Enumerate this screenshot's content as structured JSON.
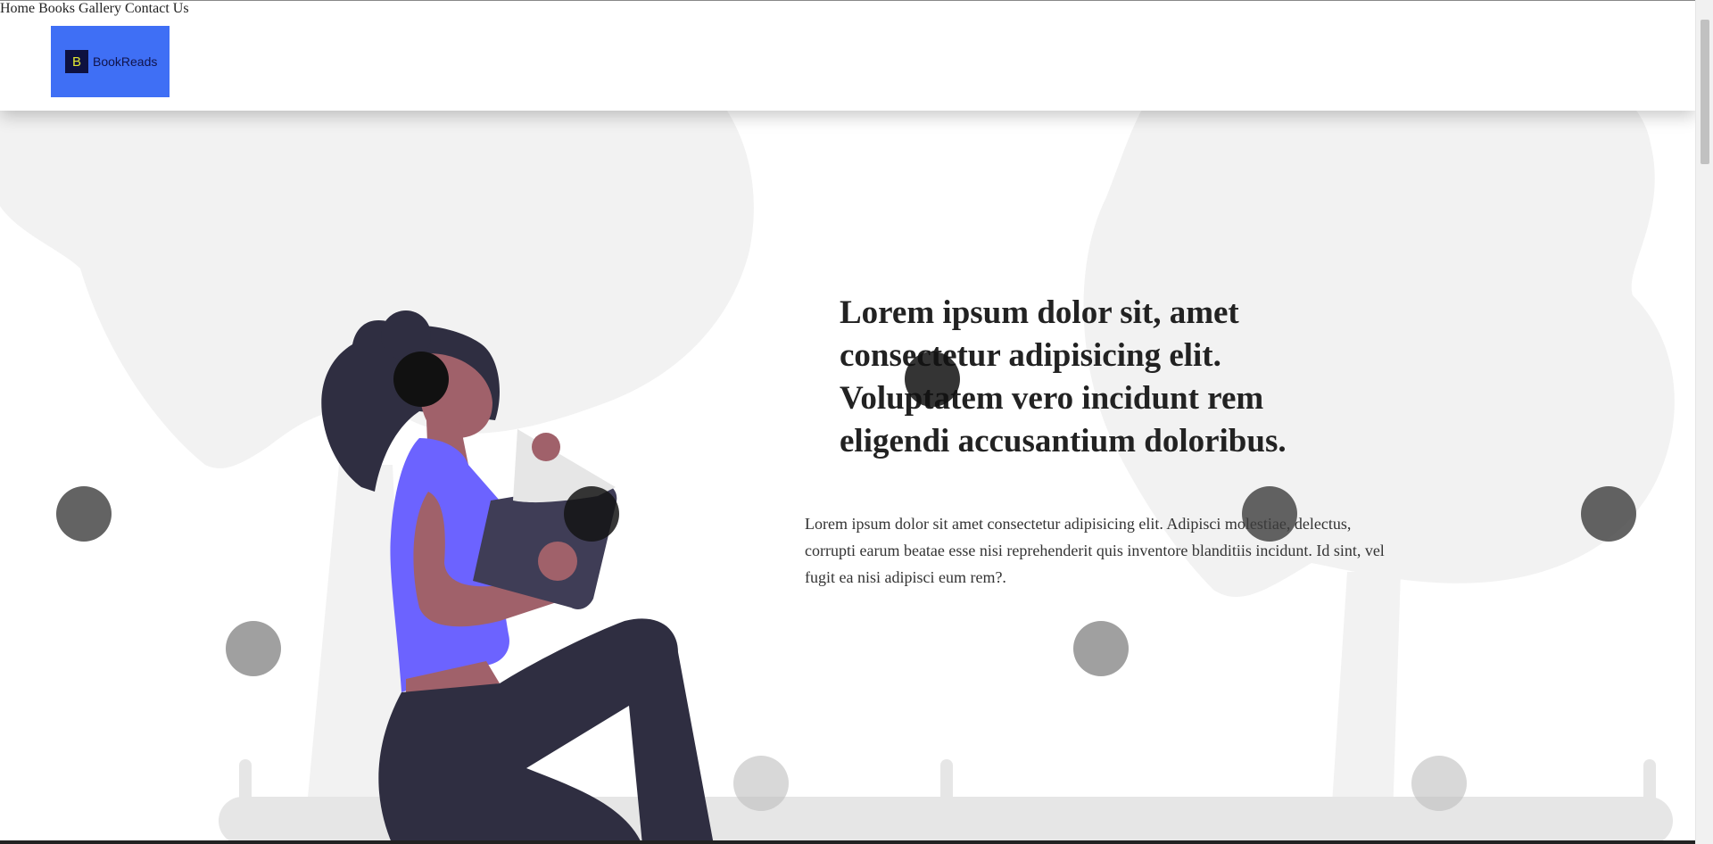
{
  "brand": {
    "mark": "B",
    "name": "BookReads"
  },
  "nav": [
    {
      "label": "Home"
    },
    {
      "label": "Books"
    },
    {
      "label": "Gallery"
    },
    {
      "label": "Contact Us"
    }
  ],
  "hero": {
    "title": "Lorem ipsum dolor sit, amet consectetur adipisicing elit. Voluptatem vero incidunt rem eligendi accusantium doloribus.",
    "body": "Lorem ipsum dolor sit amet consectetur adipisicing elit. Adipisci molestiae, delectus, corrupti earum beatae esse nisi reprehenderit quis inventore blanditiis incidunt. Id sint, vel fugit ea nisi adipisci eum rem?."
  },
  "colors": {
    "logo_bg": "#3f6ff5",
    "shirt": "#6c63ff",
    "dark": "#2f2e41",
    "skin": "#a0616a",
    "tree": "#f2f2f2"
  }
}
